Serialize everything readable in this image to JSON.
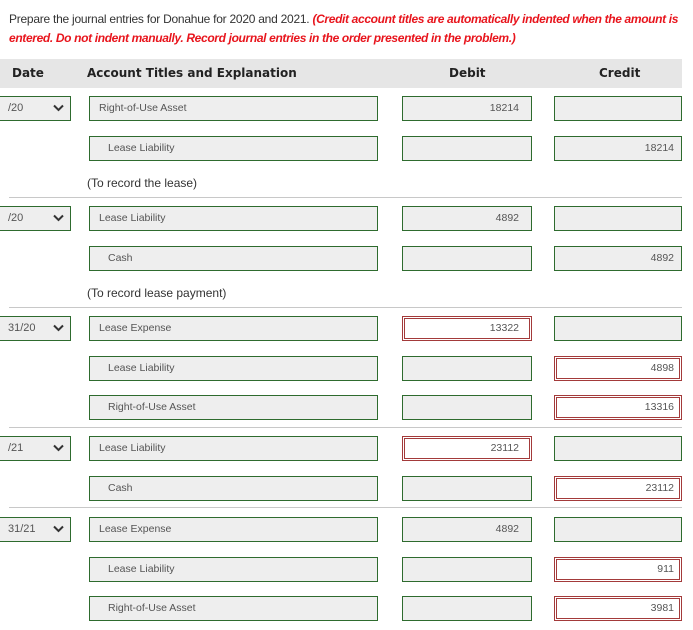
{
  "instructions": {
    "text": "Prepare the journal entries for Donahue for 2020 and 2021. ",
    "warning": "(Credit account titles are automatically indented when the amount is entered. Do not indent manually. Record journal entries in the order presented in the problem.)"
  },
  "header": {
    "date": "Date",
    "account": "Account Titles and Explanation",
    "debit": "Debit",
    "credit": "Credit"
  },
  "colors": {
    "correct_border": "#2e6b2e",
    "incorrect_border": "#a33a3a",
    "warning_text": "#e8141c",
    "header_bg": "#e6e6e6"
  },
  "entries": [
    {
      "date": "/20",
      "rows": [
        {
          "account": "Right-of-Use Asset",
          "debit": "18214",
          "credit": "",
          "indent": false,
          "debit_status": "ok",
          "credit_status": "ok"
        },
        {
          "account": "Lease Liability",
          "debit": "",
          "credit": "18214",
          "indent": true,
          "debit_status": "ok",
          "credit_status": "ok"
        }
      ],
      "explanation": "(To record the lease)"
    },
    {
      "date": "/20",
      "rows": [
        {
          "account": "Lease Liability",
          "debit": "4892",
          "credit": "",
          "indent": false,
          "debit_status": "ok",
          "credit_status": "ok"
        },
        {
          "account": "Cash",
          "debit": "",
          "credit": "4892",
          "indent": true,
          "debit_status": "ok",
          "credit_status": "ok"
        }
      ],
      "explanation": "(To record lease payment)"
    },
    {
      "date": "31/20",
      "rows": [
        {
          "account": "Lease Expense",
          "debit": "13322",
          "credit": "",
          "indent": false,
          "debit_status": "incorrect",
          "credit_status": "ok"
        },
        {
          "account": "Lease Liability",
          "debit": "",
          "credit": "4898",
          "indent": true,
          "debit_status": "ok",
          "credit_status": "incorrect"
        },
        {
          "account": "Right-of-Use Asset",
          "debit": "",
          "credit": "13316",
          "indent": true,
          "debit_status": "ok",
          "credit_status": "incorrect"
        }
      ]
    },
    {
      "date": "/21",
      "rows": [
        {
          "account": "Lease Liability",
          "debit": "23112",
          "credit": "",
          "indent": false,
          "debit_status": "incorrect",
          "credit_status": "ok"
        },
        {
          "account": "Cash",
          "debit": "",
          "credit": "23112",
          "indent": true,
          "debit_status": "ok",
          "credit_status": "incorrect"
        }
      ]
    },
    {
      "date": "31/21",
      "rows": [
        {
          "account": "Lease Expense",
          "debit": "4892",
          "credit": "",
          "indent": false,
          "debit_status": "ok",
          "credit_status": "ok"
        },
        {
          "account": "Lease Liability",
          "debit": "",
          "credit": "911",
          "indent": true,
          "debit_status": "ok",
          "credit_status": "incorrect"
        },
        {
          "account": "Right-of-Use Asset",
          "debit": "",
          "credit": "3981",
          "indent": true,
          "debit_status": "ok",
          "credit_status": "incorrect"
        }
      ]
    }
  ]
}
